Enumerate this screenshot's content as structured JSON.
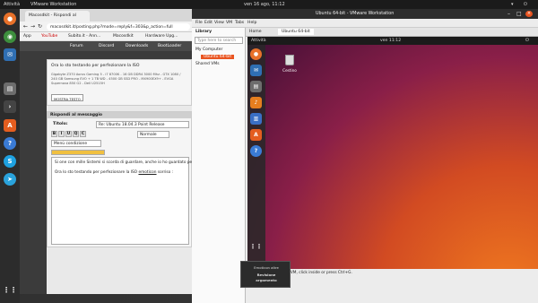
{
  "host_topbar": {
    "activities": "Attività",
    "app_menu": "VMware Workstation",
    "clock": "ven 16 ago, 11:12"
  },
  "host_dock": {
    "items": [
      "firefox-icon",
      "chrome-icon",
      "mail-icon",
      "files-icon",
      "terminal-icon",
      "appstore-icon",
      "help-icon",
      "skype-icon",
      "telegram-icon",
      "apps-grid-icon"
    ]
  },
  "browser": {
    "tab_title": "Macosdkit - Rispondi al",
    "url": "macosdkit.it/posting.php?mode=reply&f=303&p_action=full",
    "bookmarks": [
      "App",
      "YouTube",
      "Subito.it - Ann...",
      "Macosdkit",
      "Hardware Upg..."
    ],
    "site_nav": [
      "Forum",
      "Discord",
      "Downloads",
      "BootLoader"
    ],
    "post_text": "Ora lo sto testando per perfezionare la ISO",
    "post_signature": "Gigabyte Z370 Aorus Gaming 5 - i7 8700K - 16 GB DDR4 3000 Mhz - GTX 1080 / 240 GB Samsung EVO + 1 TB WD - 4500 GB SSD PRO - MX900EX9+ - EVGA Supernova 850 G2 - Dell U2515H",
    "show_text_button": "MOSTRA TESTO",
    "reply_header": "Rispondi al messaggio",
    "title_label": "Titolo:",
    "title_value": "Re: Ubuntu 18.04.3 Point Release",
    "format_buttons": [
      "B",
      "I",
      "U",
      "Q",
      "C"
    ],
    "size_select": "Normale",
    "font_select": "Menù condizione",
    "body_line1": "Si one con mille Sistemi si scorda di guardare, anche io ho guardato per...",
    "body_line2": "Ora lo sto testando per perfezionare la ISO",
    "body_emoticon_label": "emoticon",
    "body_line2_tail": "sorriso :"
  },
  "vmware": {
    "title": "Ubuntu 64-bit - VMware Workstation",
    "menu": [
      "File",
      "Edit",
      "View",
      "VM",
      "Tabs",
      "Help"
    ],
    "library_label": "Library",
    "library_search": "Type here to search",
    "library_items": [
      "My Computer",
      "Ubuntu 64-bit",
      "Shared VMs"
    ],
    "tabs": [
      "Home",
      "Ubuntu 64-bit"
    ],
    "guest_topbar_left": "Attività",
    "guest_clock": "ven 11:12",
    "guest_dock_icons": [
      "firefox-icon",
      "mail-icon",
      "files-icon",
      "music-icon",
      "document-icon",
      "appstore-icon",
      "help-icon",
      "apps-grid-icon"
    ],
    "trash_label": "Cestino",
    "status_text": "To direct input to this VM, click inside or press Ctrl+G.",
    "popup_line1": "Emoticon altre",
    "popup_line2": "Revisione",
    "popup_line3": "argomento"
  },
  "colors": {
    "ubuntu_orange": "#e95420",
    "ubuntu_aubergine": "#3d0e35",
    "site_blue": "#1a5fa8"
  }
}
